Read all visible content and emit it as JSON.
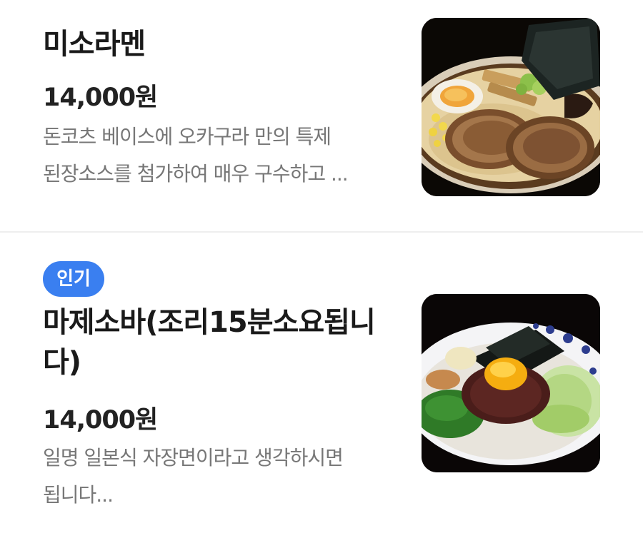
{
  "menu": {
    "items": [
      {
        "name": "미소라멘",
        "price": "14,000원",
        "description_line1": "돈코츠 베이스에 오카구라 만의 특제",
        "description_line2": "된장소스를 첨가하여 매우 구수하고 ...",
        "image": "miso-ramen-photo"
      },
      {
        "badge": "인기",
        "name_line1": "마제소바(조리15분소요됩니",
        "name_line2": "다)",
        "price": "14,000원",
        "description_line1": "일명 일본식 자장면이라고 생각하시면",
        "description_line2": "됩니다...",
        "image": "mazesoba-photo"
      }
    ]
  },
  "colors": {
    "badge": "#3a7ff0",
    "text_primary": "#1a1a1a",
    "text_secondary": "#777777",
    "divider": "#eeeeee"
  }
}
